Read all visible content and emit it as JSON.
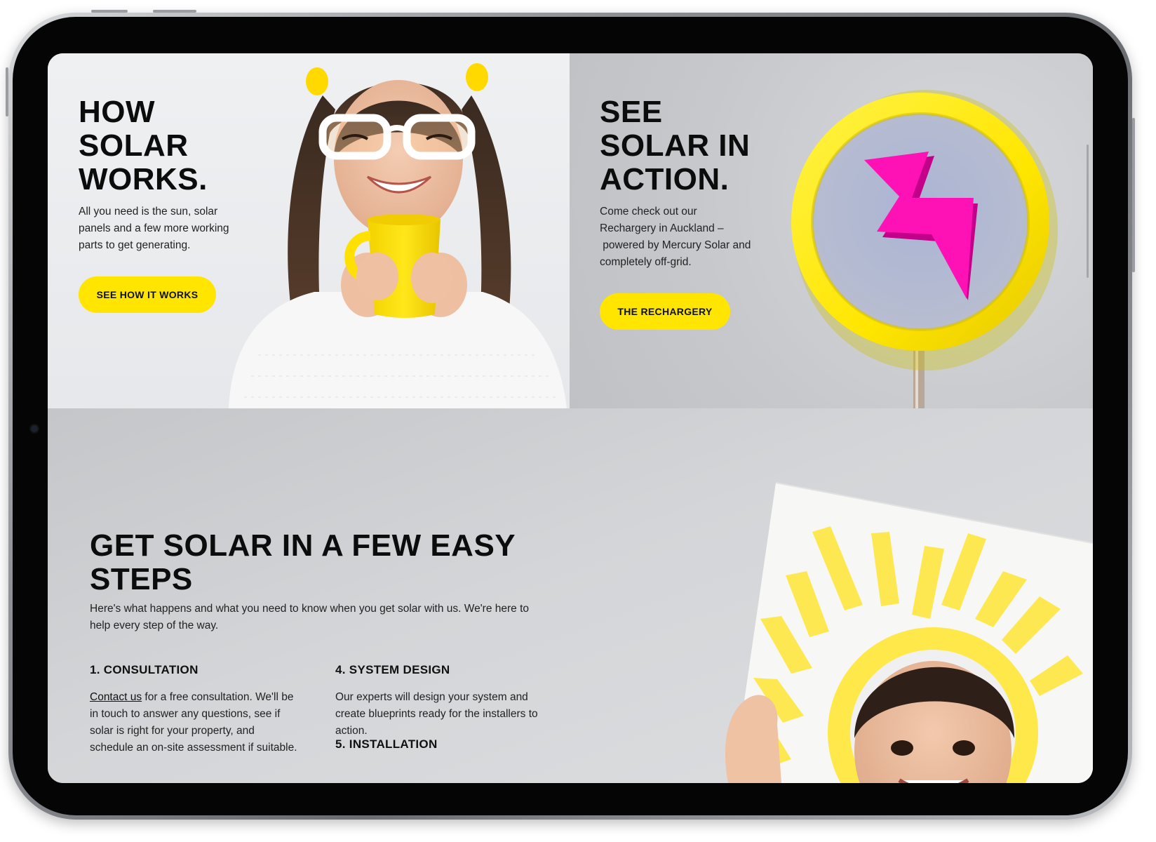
{
  "colors": {
    "accent_yellow": "#ffe500",
    "bolt_pink": "#ff12b5",
    "text_dark": "#0c0c0c"
  },
  "panel_left": {
    "title_lines": [
      "HOW",
      "SOLAR",
      "WORKS."
    ],
    "body": "All you need is the sun, solar panels and a few more working parts to get generating.",
    "button_label": "SEE HOW IT WORKS",
    "image_alt": "girl-with-glasses-and-yellow-mug"
  },
  "panel_right": {
    "title_lines": [
      "SEE",
      "SOLAR IN",
      "ACTION."
    ],
    "body_lines": [
      "Come check out our",
      "Rechargery in Auckland –",
      " powered by Mercury Solar and",
      "completely off-grid."
    ],
    "button_label": "THE RECHARGERY",
    "icon": "lightning-bolt-sign-icon"
  },
  "steps": {
    "title_lines": [
      "GET SOLAR IN A FEW EASY",
      "STEPS"
    ],
    "intro": "Here's what happens and what you need to know when you get solar with us. We're here to help every step of the way.",
    "items": [
      {
        "heading": "1. CONSULTATION",
        "link_text": "Contact us",
        "body": " for a free consultation. We'll be in touch to answer any questions, see if solar is right for your property, and schedule an on-site assessment if suitable."
      },
      {
        "heading": "4. SYSTEM DESIGN",
        "body": "Our experts will design your system and create blueprints ready for the installers to action."
      },
      {
        "heading": "5. INSTALLATION",
        "body": ""
      }
    ],
    "image_alt": "girl-framed-by-painted-sun"
  }
}
